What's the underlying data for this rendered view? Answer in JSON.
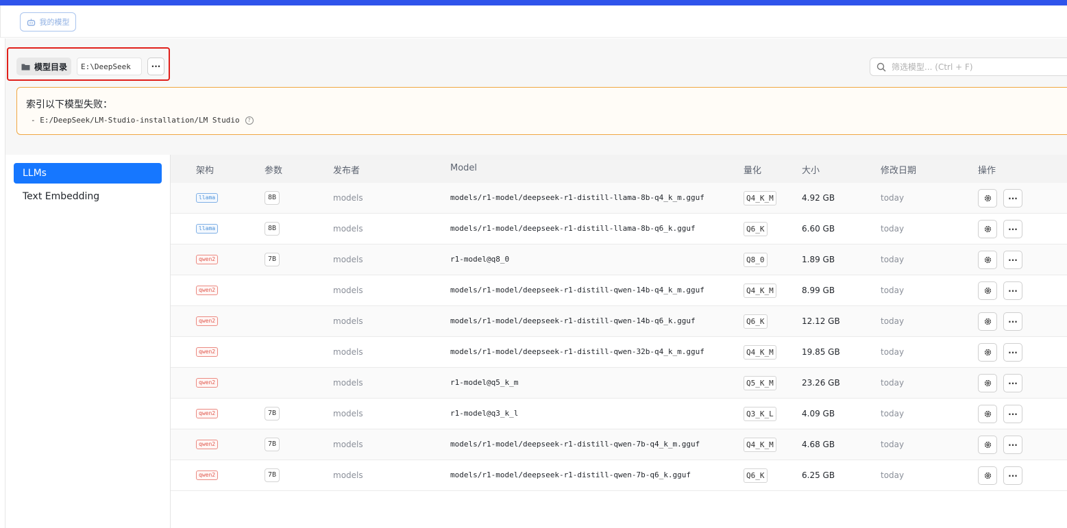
{
  "colors": {
    "accent": "#1677ff",
    "top_bar": "#2f54eb",
    "warning_border": "#f0a742",
    "highlight_box": "#e0201b",
    "llama_tag": "#4a90d9",
    "qwen2_tag": "#e05a4f"
  },
  "tabs": {
    "my_models": "我的模型"
  },
  "directory": {
    "label": "模型目录",
    "path": "E:\\DeepSeek",
    "more": "···"
  },
  "search": {
    "placeholder": "筛选模型... (Ctrl + F)"
  },
  "warning": {
    "title": "索引以下模型失败：",
    "item": "- E:/DeepSeek/LM-Studio-installation/LM Studio",
    "help": "?"
  },
  "sidebar": {
    "items": [
      {
        "label": "LLMs",
        "active": true
      },
      {
        "label": "Text Embedding",
        "active": false
      }
    ]
  },
  "table": {
    "headers": {
      "arch": "架构",
      "params": "参数",
      "publisher": "发布者",
      "model": "Model",
      "quant": "量化",
      "size": "大小",
      "modified": "修改日期",
      "actions": "操作"
    },
    "rows": [
      {
        "arch": "llama",
        "params": "8B",
        "publisher": "models",
        "model": "models/r1-model/deepseek-r1-distill-llama-8b-q4_k_m.gguf",
        "quant": "Q4_K_M",
        "size": "4.92 GB",
        "modified": "today"
      },
      {
        "arch": "llama",
        "params": "8B",
        "publisher": "models",
        "model": "models/r1-model/deepseek-r1-distill-llama-8b-q6_k.gguf",
        "quant": "Q6_K",
        "size": "6.60 GB",
        "modified": "today"
      },
      {
        "arch": "qwen2",
        "params": "7B",
        "publisher": "models",
        "model": "r1-model@q8_0",
        "quant": "Q8_0",
        "size": "1.89 GB",
        "modified": "today"
      },
      {
        "arch": "qwen2",
        "params": "",
        "publisher": "models",
        "model": "models/r1-model/deepseek-r1-distill-qwen-14b-q4_k_m.gguf",
        "quant": "Q4_K_M",
        "size": "8.99 GB",
        "modified": "today"
      },
      {
        "arch": "qwen2",
        "params": "",
        "publisher": "models",
        "model": "models/r1-model/deepseek-r1-distill-qwen-14b-q6_k.gguf",
        "quant": "Q6_K",
        "size": "12.12 GB",
        "modified": "today"
      },
      {
        "arch": "qwen2",
        "params": "",
        "publisher": "models",
        "model": "models/r1-model/deepseek-r1-distill-qwen-32b-q4_k_m.gguf",
        "quant": "Q4_K_M",
        "size": "19.85 GB",
        "modified": "today"
      },
      {
        "arch": "qwen2",
        "params": "",
        "publisher": "models",
        "model": "r1-model@q5_k_m",
        "quant": "Q5_K_M",
        "size": "23.26 GB",
        "modified": "today"
      },
      {
        "arch": "qwen2",
        "params": "7B",
        "publisher": "models",
        "model": "r1-model@q3_k_l",
        "quant": "Q3_K_L",
        "size": "4.09 GB",
        "modified": "today"
      },
      {
        "arch": "qwen2",
        "params": "7B",
        "publisher": "models",
        "model": "models/r1-model/deepseek-r1-distill-qwen-7b-q4_k_m.gguf",
        "quant": "Q4_K_M",
        "size": "4.68 GB",
        "modified": "today"
      },
      {
        "arch": "qwen2",
        "params": "7B",
        "publisher": "models",
        "model": "models/r1-model/deepseek-r1-distill-qwen-7b-q6_k.gguf",
        "quant": "Q6_K",
        "size": "6.25 GB",
        "modified": "today"
      }
    ],
    "row_icons": {
      "settings": "gear-icon",
      "more": "more-icon"
    },
    "more_label": "···"
  }
}
